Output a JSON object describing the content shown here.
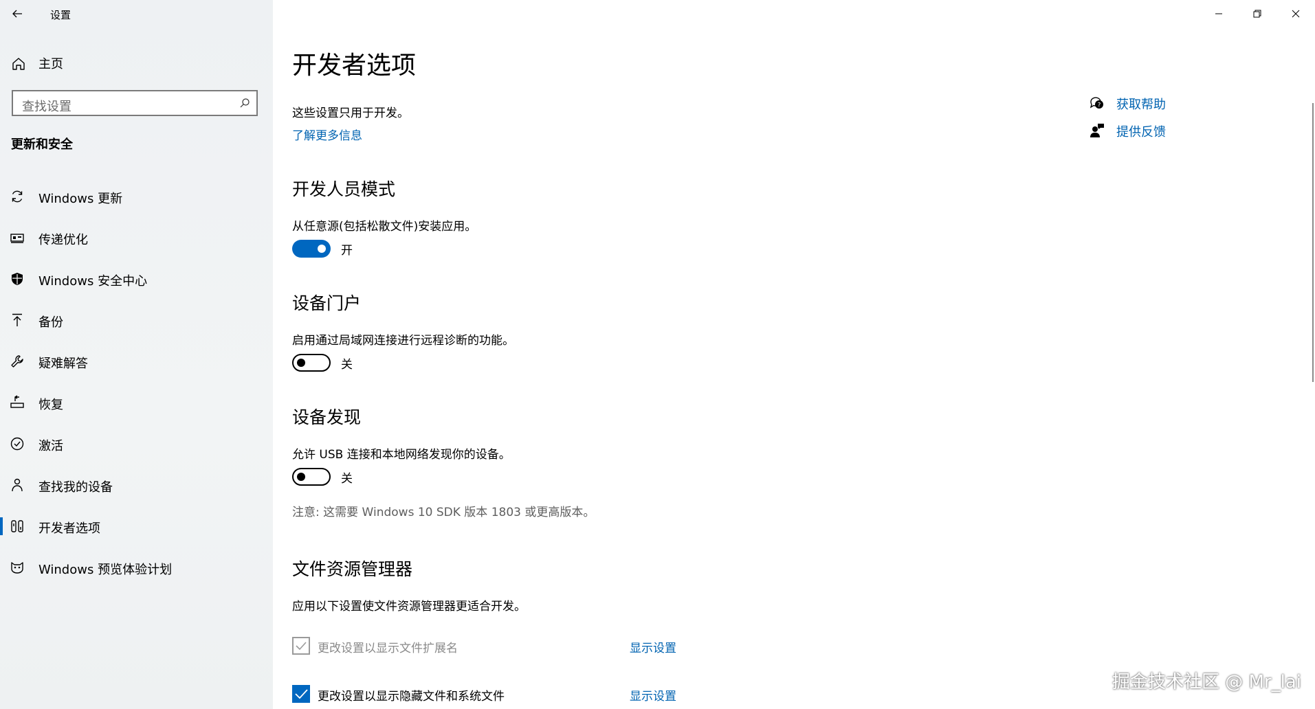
{
  "titlebar": {
    "app_title": "设置"
  },
  "sidebar": {
    "home_label": "主页",
    "search_placeholder": "查找设置",
    "section_title": "更新和安全",
    "items": [
      {
        "label": "Windows 更新",
        "icon": "sync-icon"
      },
      {
        "label": "传递优化",
        "icon": "delivery-icon"
      },
      {
        "label": "Windows 安全中心",
        "icon": "shield-icon"
      },
      {
        "label": "备份",
        "icon": "upload-icon"
      },
      {
        "label": "疑难解答",
        "icon": "wrench-icon"
      },
      {
        "label": "恢复",
        "icon": "recovery-icon"
      },
      {
        "label": "激活",
        "icon": "check-circle-icon"
      },
      {
        "label": "查找我的设备",
        "icon": "person-location-icon"
      },
      {
        "label": "开发者选项",
        "icon": "developer-icon",
        "active": true
      },
      {
        "label": "Windows 预览体验计划",
        "icon": "insider-cat-icon"
      }
    ]
  },
  "main": {
    "title": "开发者选项",
    "description": "这些设置只用于开发。",
    "learn_more": "了解更多信息",
    "developer_mode": {
      "heading": "开发人员模式",
      "text": "从任意源(包括松散文件)安装应用。",
      "state_label": "开",
      "on": true
    },
    "device_portal": {
      "heading": "设备门户",
      "text": "启用通过局域网连接进行远程诊断的功能。",
      "state_label": "关",
      "on": false
    },
    "device_discovery": {
      "heading": "设备发现",
      "text": "允许 USB 连接和本地网络发现你的设备。",
      "state_label": "关",
      "on": false,
      "note": "注意: 这需要 Windows 10 SDK 版本 1803 或更高版本。"
    },
    "file_explorer": {
      "heading": "文件资源管理器",
      "text": "应用以下设置使文件资源管理器更适合开发。",
      "options": [
        {
          "label": "更改设置以显示文件扩展名",
          "checked": true,
          "disabled": true,
          "link": "显示设置"
        },
        {
          "label": "更改设置以显示隐藏文件和系统文件",
          "checked": true,
          "disabled": false,
          "link": "显示设置"
        }
      ]
    },
    "help": {
      "get_help": "获取帮助",
      "feedback": "提供反馈"
    }
  },
  "watermark": "掘金技术社区 @ Mr_lai",
  "colors": {
    "accent": "#0067c0",
    "link": "#0063b1",
    "sidebar_bg": "#f0f2f4"
  }
}
